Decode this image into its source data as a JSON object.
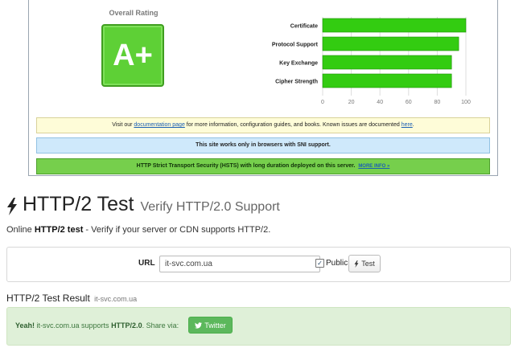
{
  "ssl_report": {
    "rating_title": "Overall Rating",
    "grade": "A+",
    "notices": {
      "doc_prefix": "Visit our ",
      "doc_link": "documentation page",
      "doc_middle": " for more information, configuration guides, and books. Known issues are documented ",
      "doc_here": "here",
      "doc_suffix": ".",
      "sni": "This site works only in browsers with SNI support.",
      "hsts": "HTTP Strict Transport Security (HSTS) with long duration deployed on this server.",
      "hsts_link": "MORE INFO »"
    },
    "colors": {
      "bar": "#33cc11",
      "grade_bg": "#5ed036",
      "notice_green": "#76cf4c"
    }
  },
  "chart_data": {
    "type": "bar",
    "orientation": "horizontal",
    "categories": [
      "Certificate",
      "Protocol Support",
      "Key Exchange",
      "Cipher Strength"
    ],
    "values": [
      100,
      95,
      90,
      90
    ],
    "xlim": [
      0,
      100
    ],
    "xticks": [
      0,
      20,
      40,
      60,
      80,
      100
    ],
    "grid": true
  },
  "http2": {
    "title": "HTTP/2 Test",
    "subtitle": "Verify HTTP/2.0 Support",
    "desc_prefix": "Online ",
    "desc_bold": "HTTP/2 test",
    "desc_suffix": " - Verify if your server or CDN supports HTTP/2.",
    "form": {
      "url_label": "URL",
      "url_value": "it-svc.com.ua",
      "public_label": "Public",
      "public_checked": true,
      "test_label": "Test"
    },
    "result": {
      "title": "HTTP/2 Test Result",
      "domain": "it-svc.com.ua",
      "yeah": "Yeah!",
      "text_mid": " it-svc.com.ua supports ",
      "text_bold": "HTTP/2.0",
      "text_suffix": ". Share via:",
      "twitter_label": "Twitter"
    }
  }
}
